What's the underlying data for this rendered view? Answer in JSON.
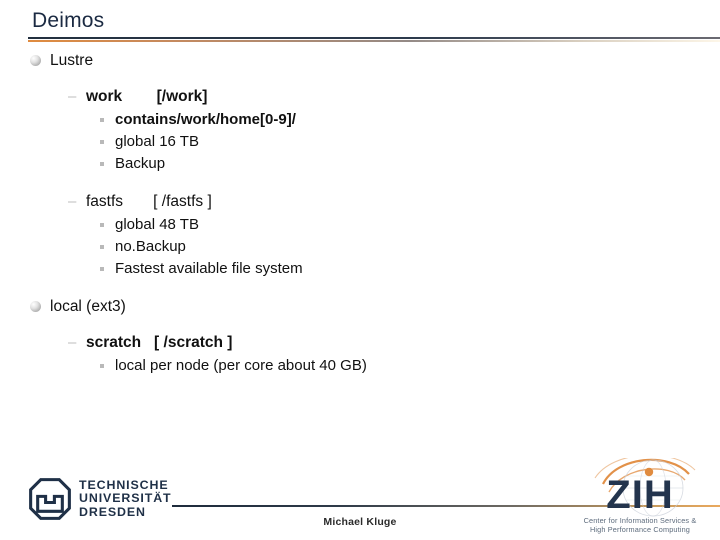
{
  "slide": {
    "title": "Deimos"
  },
  "content": {
    "sections": [
      {
        "label": "Lustre",
        "marker": "ball-bullet",
        "items": [
          {
            "label": "work        [/work]",
            "marker": "dash-bullet",
            "bold": true,
            "subitems": [
              {
                "label": "contains/work/home[0-9]/",
                "marker": "square-bullet",
                "bold": true
              },
              {
                "label": "global 16 TB",
                "marker": "square-bullet",
                "bold": false
              },
              {
                "label": "Backup",
                "marker": "square-bullet",
                "bold": false
              }
            ]
          },
          {
            "label": "fastfs       [ /fastfs ]",
            "marker": "dash-bullet",
            "bold": false,
            "subitems": [
              {
                "label": "global 48 TB",
                "marker": "square-bullet",
                "bold": false
              },
              {
                "label": "no.Backup",
                "marker": "square-bullet",
                "bold": false
              },
              {
                "label": "Fastest available file system",
                "marker": "square-bullet",
                "bold": false
              }
            ]
          }
        ]
      },
      {
        "label": "local (ext3)",
        "marker": "ball-bullet",
        "items": [
          {
            "label": "scratch   [ /scratch ]",
            "marker": "dash-bullet",
            "bold": true,
            "subitems": [
              {
                "label": "local per node (per core about 40 GB)",
                "marker": "square-bullet",
                "bold": false
              }
            ]
          }
        ]
      }
    ],
    "markers": {
      "dash": "–"
    }
  },
  "footer": {
    "author": "Michael Kluge"
  },
  "logos": {
    "tud": {
      "line1": "TECHNISCHE",
      "line2": "UNIVERSITÄT",
      "line3": "DRESDEN"
    },
    "zih": {
      "wordmark": "ZIH",
      "tagline_line1": "Center for Information Services &",
      "tagline_line2": "High Performance Computing"
    }
  },
  "colors": {
    "title": "#1b2a42",
    "accent_orange": "#e08b3f",
    "dark_navy": "#1f3047",
    "body_text": "#111111"
  }
}
